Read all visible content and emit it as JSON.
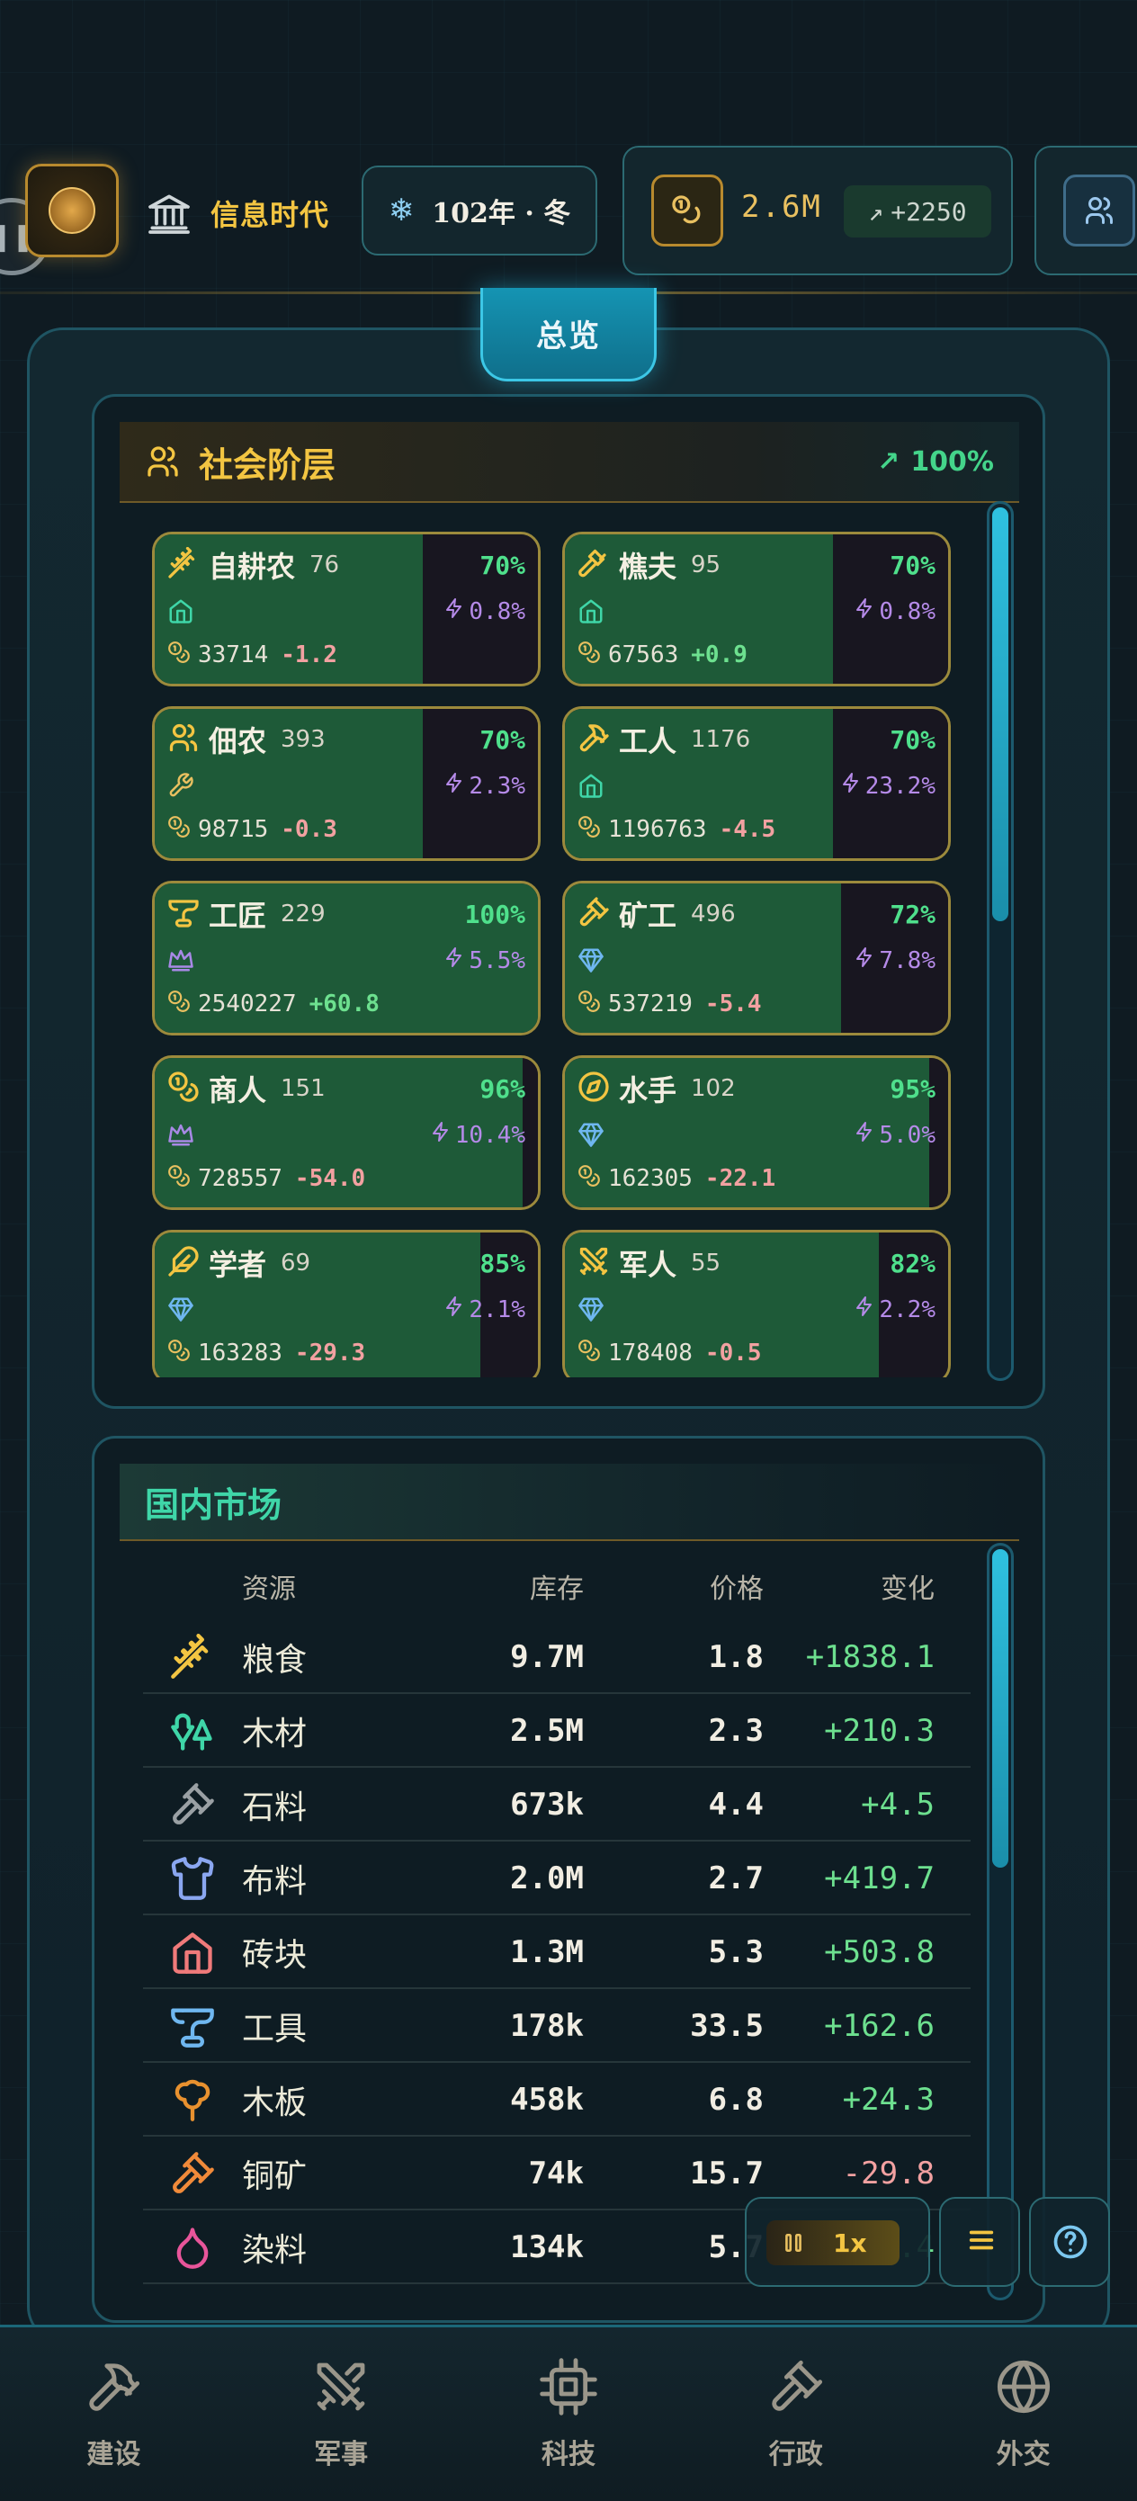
{
  "topbar": {
    "era": "信息时代",
    "date": "102年 · 冬",
    "money": "2.6M",
    "money_delta": "+2250"
  },
  "overview_tab": "总览",
  "strata": {
    "title": "社会阶层",
    "overall": "100%",
    "classes": [
      {
        "name": "自耕农",
        "count": "76",
        "happiness": "70%",
        "happiness_value": 0.7,
        "housing": "house",
        "influence": "0.8%",
        "wealth": "33714",
        "change": "-1.2",
        "icon": "wheat-icon"
      },
      {
        "name": "樵夫",
        "count": "95",
        "happiness": "70%",
        "happiness_value": 0.7,
        "housing": "house",
        "influence": "0.8%",
        "wealth": "67563",
        "change": "+0.9",
        "icon": "axe-icon"
      },
      {
        "name": "佃农",
        "count": "393",
        "happiness": "70%",
        "happiness_value": 0.7,
        "housing": "tools",
        "influence": "2.3%",
        "wealth": "98715",
        "change": "-0.3",
        "icon": "users-icon"
      },
      {
        "name": "工人",
        "count": "1176",
        "happiness": "70%",
        "happiness_value": 0.7,
        "housing": "house",
        "influence": "23.2%",
        "wealth": "1196763",
        "change": "-4.5",
        "icon": "hammer-icon"
      },
      {
        "name": "工匠",
        "count": "229",
        "happiness": "100%",
        "happiness_value": 1.0,
        "housing": "crown",
        "influence": "5.5%",
        "wealth": "2540227",
        "change": "+60.8",
        "icon": "anvil-icon"
      },
      {
        "name": "矿工",
        "count": "496",
        "happiness": "72%",
        "happiness_value": 0.72,
        "housing": "gem",
        "influence": "7.8%",
        "wealth": "537219",
        "change": "-5.4",
        "icon": "pickaxe-icon"
      },
      {
        "name": "商人",
        "count": "151",
        "happiness": "96%",
        "happiness_value": 0.96,
        "housing": "crown",
        "influence": "10.4%",
        "wealth": "728557",
        "change": "-54.0",
        "icon": "coins-icon"
      },
      {
        "name": "水手",
        "count": "102",
        "happiness": "95%",
        "happiness_value": 0.95,
        "housing": "gem",
        "influence": "5.0%",
        "wealth": "162305",
        "change": "-22.1",
        "icon": "compass-icon"
      },
      {
        "name": "学者",
        "count": "69",
        "happiness": "85%",
        "happiness_value": 0.85,
        "housing": "gem",
        "influence": "2.1%",
        "wealth": "163283",
        "change": "-29.3",
        "icon": "feather-icon"
      },
      {
        "name": "军人",
        "count": "55",
        "happiness": "82%",
        "happiness_value": 0.82,
        "housing": "gem",
        "influence": "2.2%",
        "wealth": "178408",
        "change": "-0.5",
        "icon": "swords-icon"
      }
    ]
  },
  "market": {
    "title": "国内市场",
    "headers": {
      "resource": "资源",
      "stock": "库存",
      "price": "价格",
      "change": "变化"
    },
    "rows": [
      {
        "name": "粮食",
        "stock": "9.7M",
        "price": "1.8",
        "change": "+1838.1",
        "icon": "wheat-icon",
        "color": "#f3c542"
      },
      {
        "name": "木材",
        "stock": "2.5M",
        "price": "2.3",
        "change": "+210.3",
        "icon": "trees-icon",
        "color": "#3fd6a8"
      },
      {
        "name": "石料",
        "stock": "673k",
        "price": "4.4",
        "change": "+4.5",
        "icon": "pickaxe-icon",
        "color": "#9aa0a4"
      },
      {
        "name": "布料",
        "stock": "2.0M",
        "price": "2.7",
        "change": "+419.7",
        "icon": "shirt-icon",
        "color": "#8aa6f0"
      },
      {
        "name": "砖块",
        "stock": "1.3M",
        "price": "5.3",
        "change": "+503.8",
        "icon": "house-icon",
        "color": "#f07a7a"
      },
      {
        "name": "工具",
        "stock": "178k",
        "price": "33.5",
        "change": "+162.6",
        "icon": "anvil-icon",
        "color": "#6fb7f0"
      },
      {
        "name": "木板",
        "stock": "458k",
        "price": "6.8",
        "change": "+24.3",
        "icon": "tree-icon",
        "color": "#e8912f"
      },
      {
        "name": "铜矿",
        "stock": "74k",
        "price": "15.7",
        "change": "-29.8",
        "icon": "pickaxe-icon",
        "color": "#f08a3a"
      },
      {
        "name": "染料",
        "stock": "134k",
        "price": "5.7",
        "change": "+6.4",
        "icon": "droplet-icon",
        "color": "#e8559a"
      }
    ]
  },
  "controls": {
    "speed": "1x"
  },
  "nav": [
    {
      "label": "建设",
      "icon": "hammer-icon"
    },
    {
      "label": "军事",
      "icon": "swords-icon"
    },
    {
      "label": "科技",
      "icon": "chip-icon"
    },
    {
      "label": "行政",
      "icon": "gavel-icon"
    },
    {
      "label": "外交",
      "icon": "globe-icon"
    }
  ]
}
